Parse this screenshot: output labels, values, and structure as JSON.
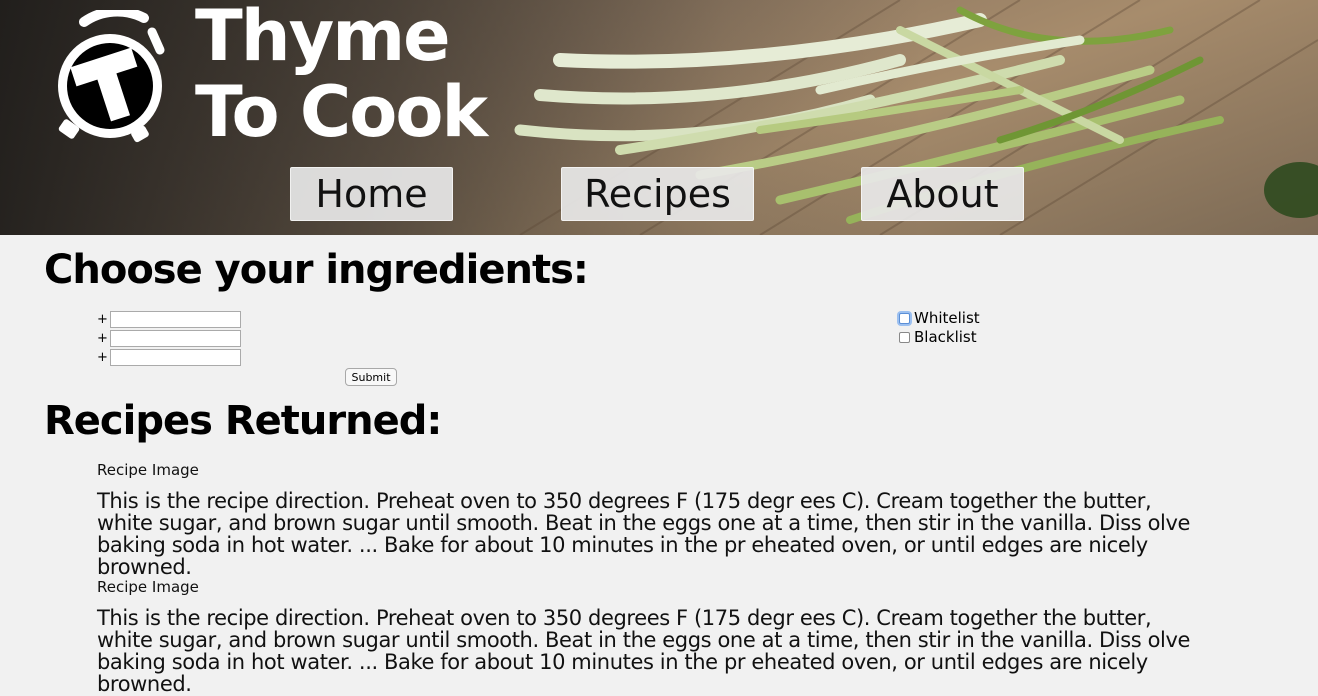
{
  "brand": {
    "line1": "Thyme",
    "line2": "To Cook"
  },
  "nav": {
    "home": "Home",
    "recipes": "Recipes",
    "about": "About"
  },
  "ingredients": {
    "heading": "Choose your ingredients:",
    "rows": [
      {
        "prefix": "+",
        "value": ""
      },
      {
        "prefix": "+",
        "value": ""
      },
      {
        "prefix": "+",
        "value": ""
      }
    ],
    "submit_label": "Submit",
    "options": [
      {
        "label": "Whitelist",
        "checked": false
      },
      {
        "label": "Blacklist",
        "checked": false
      }
    ]
  },
  "results": {
    "heading": "Recipes Returned:",
    "recipes": [
      {
        "image_label": "Recipe Image",
        "direction": "This is the recipe direction. Preheat oven to 350 degrees F (175 degr ees C). Cream together the butter, white sugar, and brown sugar until smooth. Beat in the eggs one at a time, then stir in the vanilla. Diss olve baking soda in hot water. ... Bake for about 10 minutes in the pr eheated oven, or until edges are nicely browned."
      },
      {
        "image_label": "Recipe Image",
        "direction": "This is the recipe direction. Preheat oven to 350 degrees F (175 degr ees C). Cream together the butter, white sugar, and brown sugar until smooth. Beat in the eggs one at a time, then stir in the vanilla. Diss olve baking soda in hot water. ... Bake for about 10 minutes in the pr eheated oven, or until edges are nicely browned."
      }
    ]
  },
  "icons": {
    "logo": "timer-t-logo-icon"
  },
  "colors": {
    "page_bg": "#f1f1f1",
    "nav_button_bg": "#e8e8e8",
    "heading": "#000000",
    "focus_ring": "#5b8fd6"
  }
}
